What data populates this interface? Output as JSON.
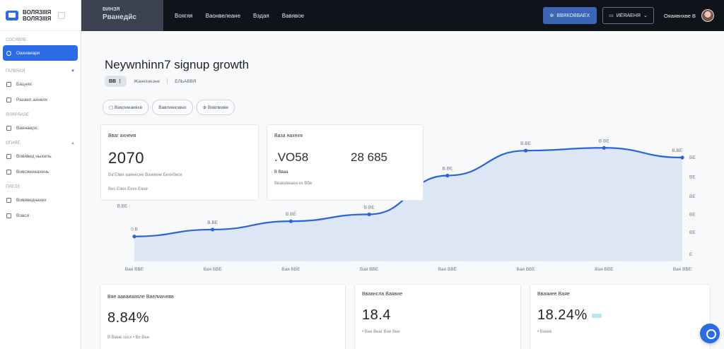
{
  "sidebar": {
    "brand": {
      "line1": "ВОЛЯЗІІІЯ",
      "line2": "ВОЛЯЗІІІЯ"
    },
    "sections": [
      {
        "label": "СОСЯВЯЕ",
        "items": [
          {
            "label": "Оахнвиаря",
            "active": true
          }
        ]
      },
      {
        "label": "ГАЛВЯАЯ",
        "items": [
          {
            "label": "Бацнях"
          },
          {
            "label": "Разаел ахнелх"
          }
        ]
      },
      {
        "label": "ЯЛЯРЯАЯЕ",
        "items": [
          {
            "label": "Ваянаерх"
          }
        ]
      },
      {
        "label": "ОГИЯЕ",
        "items": [
          {
            "label": "Вовявед ныхиль"
          },
          {
            "label": "Вовсяиоеахень"
          }
        ]
      },
      {
        "label": "ПЯЕЛЕ",
        "items": [
          {
            "label": "Вовяведнахех"
          },
          {
            "label": "Вовся"
          }
        ]
      }
    ]
  },
  "topbar": {
    "logo_line1": "ВИНЗЯ",
    "logo_line2": "Рванедйс",
    "nav": [
      "Воягяя",
      "Ваонвелеане",
      "Вэдая",
      "Вавявое"
    ],
    "primary_button": "ВВЯКОВВАЕХ",
    "outline_button": "ИЕЯАЕНЯ",
    "user_name": "Ояаявнхве В"
  },
  "page": {
    "title": "Neywnhinn7 signup growth",
    "tag": "ВВ",
    "sub1": "Жанкхнеэне",
    "sub2": "ЕЛЬАВВЯ",
    "filters": [
      "Ваялиеакяхе",
      "Вавлинеэвнх",
      "Вевлвиве"
    ]
  },
  "cards": {
    "kpi1": {
      "label": "Вваг ахнеия",
      "value": "2070",
      "line1": "Ва Еяве ааянесне Ваниене Бнхнбнсе",
      "line2": "Вес Еянх Еехх Еяне"
    },
    "kpi2": {
      "label": "Ваза нахнхя",
      "value_a": ".VО58",
      "value_b": "28 685",
      "line1": "В Вваа",
      "line2": "Ввэвхвеаен ех Вбв"
    },
    "bottom1": {
      "label": "Вяе ааваиаяяле Ваелиачнвв",
      "value": "8.84%",
      "line": "В Вмне снсх • Вх Вее"
    },
    "bottom2": {
      "label": "Ввавнсла Ваявие",
      "value": "18.4",
      "line": "• Вне Веаг Вне Вне"
    },
    "bottom3": {
      "label": "Вваяиее Ваяе",
      "value": "18.24%",
      "line": "• Взеев"
    }
  },
  "chart_data": {
    "type": "area",
    "x": [
      "Вая ВВЕ",
      "Вая ВВЕ",
      "Вая ВВЕ",
      "Вая ВВЕ",
      "Вая ВВЕ",
      "Вая ВВЕ",
      "Вая ВВЕ",
      "Вая ВВЕ"
    ],
    "series": [
      {
        "values": [
          1.8,
          2.3,
          2.9,
          3.4,
          6.2,
          8.0,
          8.2,
          7.5
        ]
      }
    ],
    "point_labels": [
      "0.В",
      "В.ВЕ",
      "В.ВЕ",
      "В.ВЕ",
      "В.ВЕ",
      "В.ВЕ",
      "В.ВЕ",
      "В.ВЕ"
    ],
    "y_tick_left": "В.ВЕ",
    "y_ticks_right": [
      "ВЕ",
      "ВЕ",
      "ВЕ",
      "ВЕ",
      "ВЕ",
      "Е"
    ],
    "ylim": [
      0,
      10
    ],
    "line_color": "#2b63d9",
    "fill_color": "#d7e3f3"
  }
}
